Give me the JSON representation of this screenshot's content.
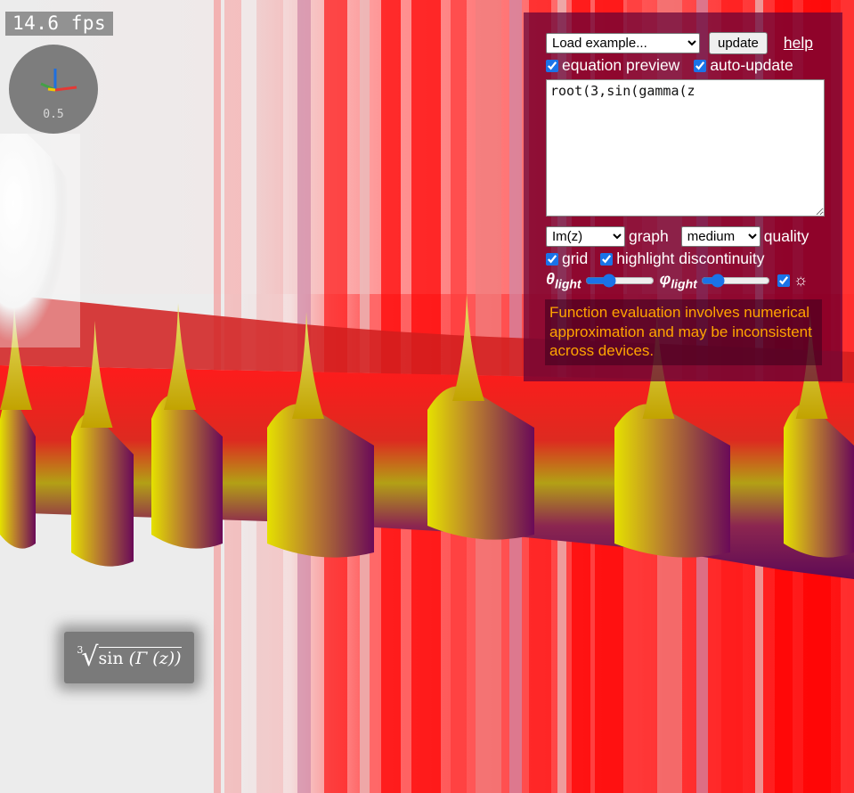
{
  "fps": "14.6 fps",
  "gizmo": {
    "scale": "0.5",
    "axis_colors": {
      "x": "#e53935",
      "y": "#43a047",
      "z": "#1e6fe0"
    }
  },
  "panel": {
    "example_select": {
      "selected": "Load example..."
    },
    "update_label": "update",
    "help_label": "help",
    "equation_preview": {
      "label": "equation preview",
      "checked": true
    },
    "auto_update": {
      "label": "auto-update",
      "checked": true
    },
    "equation": "root(3,sin(gamma(z",
    "graph_select": {
      "selected": "Im(z)"
    },
    "graph_label": "graph",
    "quality_select": {
      "selected": "medium"
    },
    "quality_label": "quality",
    "grid": {
      "label": "grid",
      "checked": true
    },
    "highlight": {
      "label": "highlight discontinuity",
      "checked": true
    },
    "theta_light": {
      "symbol": "θ",
      "sub": "light",
      "value_fraction": 0.32
    },
    "phi_light": {
      "symbol": "φ",
      "sub": "light",
      "value_fraction": 0.18
    },
    "light_toggle": {
      "checked": true,
      "icon": "sun-icon",
      "glyph": "☼"
    },
    "warning": "Function evaluation involves numerical approximation and may be inconsistent across devices."
  },
  "equation_render": {
    "index": "3",
    "func": "sin",
    "inner": "(Γ (z))"
  },
  "colors": {
    "panel_bg": "#5f0037",
    "warning_text": "#ffa500",
    "surface_red": "#ff0000",
    "surface_yellow": "#e5e000",
    "surface_purple": "#6a0a58"
  }
}
